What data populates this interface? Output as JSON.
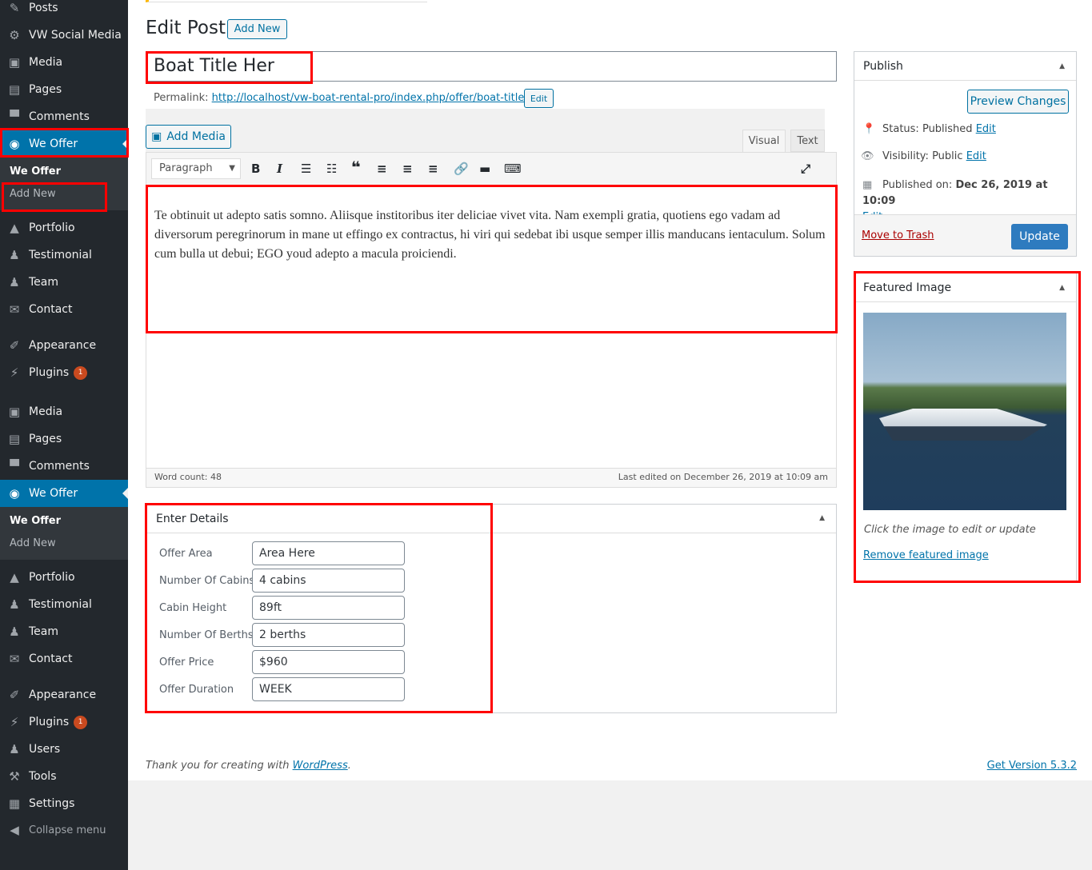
{
  "sidebar": {
    "top": [
      {
        "label": "Posts",
        "icon": "pin-icon"
      },
      {
        "label": "VW Social Media",
        "icon": "gear-icon"
      },
      {
        "label": "Media",
        "icon": "media-icon"
      },
      {
        "label": "Pages",
        "icon": "pages-icon"
      },
      {
        "label": "Comments",
        "icon": "comment-icon"
      },
      {
        "label": "We Offer",
        "icon": "globe-icon"
      }
    ],
    "sub1": [
      "We Offer",
      "Add New"
    ],
    "mid": [
      {
        "label": "Portfolio"
      },
      {
        "label": "Testimonial"
      },
      {
        "label": "Team"
      },
      {
        "label": "Contact"
      },
      {
        "label": "Appearance"
      },
      {
        "label": "Plugins",
        "badge": "1"
      },
      {
        "label": "Media"
      },
      {
        "label": "Pages"
      },
      {
        "label": "Comments"
      },
      {
        "label": "We Offer"
      }
    ],
    "sub2": [
      "We Offer",
      "Add New"
    ],
    "bottom": [
      {
        "label": "Portfolio"
      },
      {
        "label": "Testimonial"
      },
      {
        "label": "Team"
      },
      {
        "label": "Contact"
      },
      {
        "label": "Appearance"
      },
      {
        "label": "Plugins",
        "badge": "1"
      },
      {
        "label": "Users"
      },
      {
        "label": "Tools"
      },
      {
        "label": "Settings"
      },
      {
        "label": "Collapse menu"
      }
    ]
  },
  "header": {
    "title": "Edit Post",
    "add_new": "Add New"
  },
  "post": {
    "title": "Boat Title Her",
    "permalink_label": "Permalink:",
    "permalink": "http://localhost/vw-boat-rental-pro/index.php/offer/boat-title-her/",
    "edit": "Edit"
  },
  "editor": {
    "add_media": "Add Media",
    "tab_visual": "Visual",
    "tab_text": "Text",
    "format": "Paragraph",
    "content": "Te obtinuit ut adepto satis somno. Aliisque institoribus iter deliciae vivet vita. Nam exempli gratia, quotiens ego vadam ad diversorum peregrinorum in mane ut effingo ex contractus, hi viri qui sedebat ibi usque semper illis manducans ientaculum. Solum cum bulla ut debui; EGO youd adepto a macula proiciendi.",
    "word_count": "Word count: 48",
    "last_edited": "Last edited on December 26, 2019 at 10:09 am"
  },
  "details": {
    "title": "Enter Details",
    "fields": [
      {
        "label": "Offer Area",
        "value": "Area Here"
      },
      {
        "label": "Number Of Cabins",
        "value": "4 cabins"
      },
      {
        "label": "Cabin Height",
        "value": "89ft"
      },
      {
        "label": "Number Of Berths",
        "value": "2 berths"
      },
      {
        "label": "Offer Price",
        "value": "$960"
      },
      {
        "label": "Offer Duration",
        "value": "WEEK"
      }
    ]
  },
  "publish": {
    "title": "Publish",
    "preview": "Preview Changes",
    "status_label": "Status:",
    "status": "Published",
    "visibility_label": "Visibility:",
    "visibility": "Public",
    "published_label": "Published on:",
    "published": "Dec 26, 2019 at 10:09",
    "edit": "Edit",
    "trash": "Move to Trash",
    "update": "Update"
  },
  "featured": {
    "title": "Featured Image",
    "hint": "Click the image to edit or update",
    "remove": "Remove featured image"
  },
  "footer": {
    "thanks": "Thank you for creating with ",
    "wp": "WordPress",
    "version": "Get Version 5.3.2"
  },
  "colors": {
    "accent": "#0073aa",
    "sidebar": "#23282d",
    "highlight": "#ff0000"
  }
}
